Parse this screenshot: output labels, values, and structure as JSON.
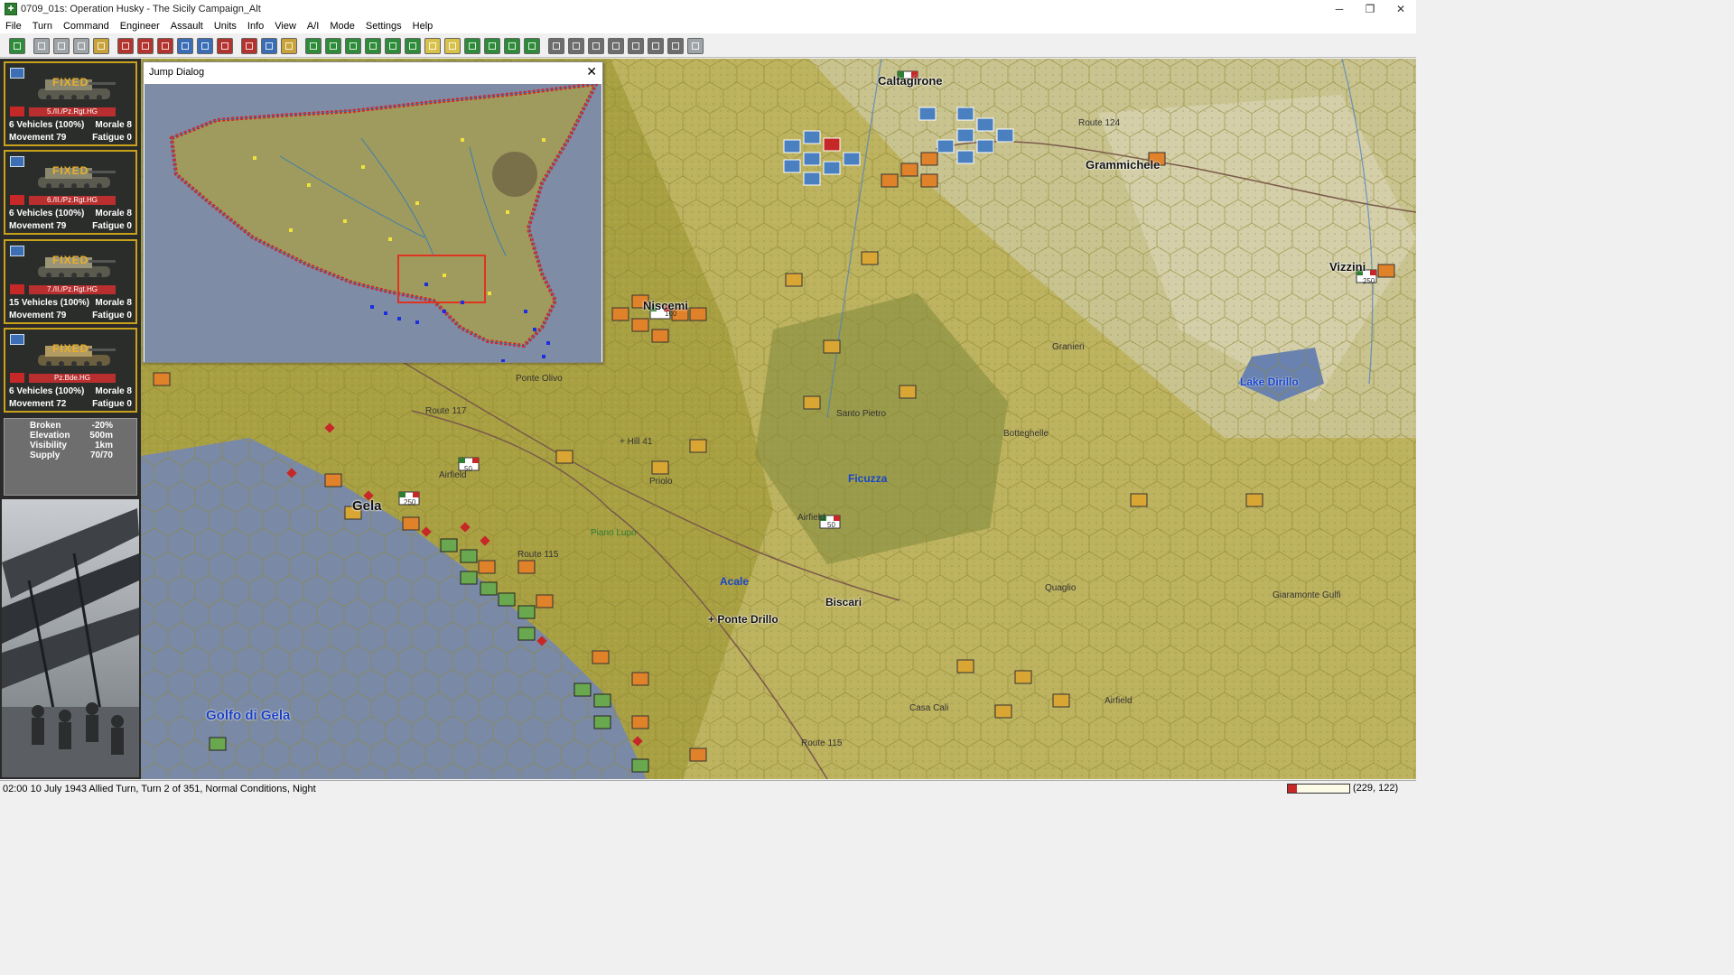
{
  "window": {
    "title": "0709_01s: Operation Husky - The Sicily Campaign_Alt",
    "minimize": "─",
    "restore": "❐",
    "close": "✕"
  },
  "menu": [
    "File",
    "Turn",
    "Command",
    "Engineer",
    "Assault",
    "Units",
    "Info",
    "View",
    "A/I",
    "Mode",
    "Settings",
    "Help"
  ],
  "toolbar": {
    "buttons": [
      {
        "icon": "target-icon",
        "color": "green"
      },
      {
        "icon": "unit-icon",
        "color": "gray"
      },
      {
        "icon": "folder-icon",
        "color": "gray"
      },
      {
        "icon": "info-icon",
        "color": "gray"
      },
      {
        "icon": "hq-icon",
        "color": "gold"
      },
      {
        "icon": "shield-icon",
        "color": "red"
      },
      {
        "icon": "s-icon",
        "color": "red"
      },
      {
        "icon": "artillery-icon",
        "color": "red"
      },
      {
        "icon": "air-icon",
        "color": "blue"
      },
      {
        "icon": "crossed-swords-icon",
        "color": "blue"
      },
      {
        "icon": "bars-icon",
        "color": "red"
      },
      {
        "icon": "pen-icon",
        "color": "red"
      },
      {
        "icon": "globe-icon",
        "color": "blue"
      },
      {
        "icon": "portrait-icon",
        "color": "gold"
      },
      {
        "icon": "zoom-in-icon",
        "color": "green"
      },
      {
        "icon": "zoom-out-icon",
        "color": "green"
      },
      {
        "icon": "grid-icon",
        "color": "green"
      },
      {
        "icon": "frame-icon",
        "color": "green"
      },
      {
        "icon": "eye-icon",
        "color": "green"
      },
      {
        "icon": "flag-icon",
        "color": "green"
      },
      {
        "icon": "arrow-icon",
        "color": "yellow"
      },
      {
        "icon": "coin-icon",
        "color": "yellow"
      },
      {
        "icon": "terrain-icon",
        "color": "green"
      },
      {
        "icon": "monitor-icon",
        "color": "green"
      },
      {
        "icon": "map-icon",
        "color": "green"
      },
      {
        "icon": "route-icon",
        "color": "green"
      },
      {
        "icon": "lock-icon",
        "color": "dark"
      },
      {
        "icon": "binoculars-icon",
        "color": "dark"
      },
      {
        "icon": "u-icon",
        "color": "dark"
      },
      {
        "icon": "circle-icon",
        "color": "dark"
      },
      {
        "icon": "list-icon",
        "color": "dark"
      },
      {
        "icon": "org-chart-icon",
        "color": "dark"
      },
      {
        "icon": "document-icon",
        "color": "dark"
      },
      {
        "icon": "help-icon",
        "color": "gray"
      }
    ]
  },
  "units": [
    {
      "status": "FIXED",
      "name": "5./II./Pz.Rgt.HG",
      "vehicles": "6 Vehicles (100%)",
      "morale": "Morale 8",
      "movement": "Movement 79",
      "fatigue": "Fatigue 0"
    },
    {
      "status": "FIXED",
      "name": "6./II./Pz.Rgt.HG",
      "vehicles": "6 Vehicles (100%)",
      "morale": "Morale 8",
      "movement": "Movement 79",
      "fatigue": "Fatigue 0"
    },
    {
      "status": "FIXED",
      "name": "7./II./Pz.Rgt.HG",
      "vehicles": "15 Vehicles (100%)",
      "morale": "Morale 8",
      "movement": "Movement 79",
      "fatigue": "Fatigue 0"
    },
    {
      "status": "FIXED",
      "name": "Pz.Bde.HG",
      "vehicles": "6 Vehicles (100%)",
      "morale": "Morale 8",
      "movement": "Movement 72",
      "fatigue": "Fatigue 0"
    }
  ],
  "terrain": {
    "broken": {
      "label": "Broken",
      "value": "-20%"
    },
    "elevation": {
      "label": "Elevation",
      "value": "500m"
    },
    "visibility": {
      "label": "Visibility",
      "value": "1km"
    },
    "supply": {
      "label": "Supply",
      "value": "70/70"
    }
  },
  "jump_dialog": {
    "title": "Jump Dialog",
    "close": "✕"
  },
  "map_labels": {
    "caltagirone": "Caltagirone",
    "route124": "Route 124",
    "grammichele": "Grammichele",
    "vizzini": "Vizzini",
    "niscemi": "Niscemi",
    "granieri": "Granieri",
    "lake_dirillo": "Lake Dirillo",
    "ponte_olivo": "Ponte Olivo",
    "route117": "Route 117",
    "santo_pietro": "Santo Pietro",
    "botteghelle": "Botteghelle",
    "hill41": "+ Hill 41",
    "airfield1": "Airfield",
    "priolo": "Priolo",
    "ficuzza": "Ficuzza",
    "gela": "Gela",
    "airfield2": "Airfield",
    "piano_lupo": "Piano Lupo",
    "route115a": "Route 115",
    "acale": "Acale",
    "quaglio": "Quaglio",
    "giaramonte": "Giaramonte Gulfi",
    "biscari": "Biscari",
    "ponte_drillo": "+ Ponte Drillo",
    "golfo": "Golfo di Gela",
    "casa_cali": "Casa Cali",
    "airfield3": "Airfield",
    "route115b": "Route 115"
  },
  "map_badges": {
    "niscemi_strength": "100",
    "gela_strength": "250",
    "airfield1_strength": "50",
    "airfield2_strength": "50",
    "vizzini_strength": "250"
  },
  "status": {
    "text": "02:00 10 July 1943 Allied Turn, Turn 2 of 351, Normal Conditions, Night",
    "progress": 0.14,
    "coords": "(229, 122)"
  },
  "colors": {
    "axis_unit": "#e0822a",
    "axis_hq": "#d9a633",
    "allied_us": "#4a7fc0",
    "allied_uk": "#6aa84f",
    "sea": "#7a8aa6",
    "land": "#a9a042"
  }
}
